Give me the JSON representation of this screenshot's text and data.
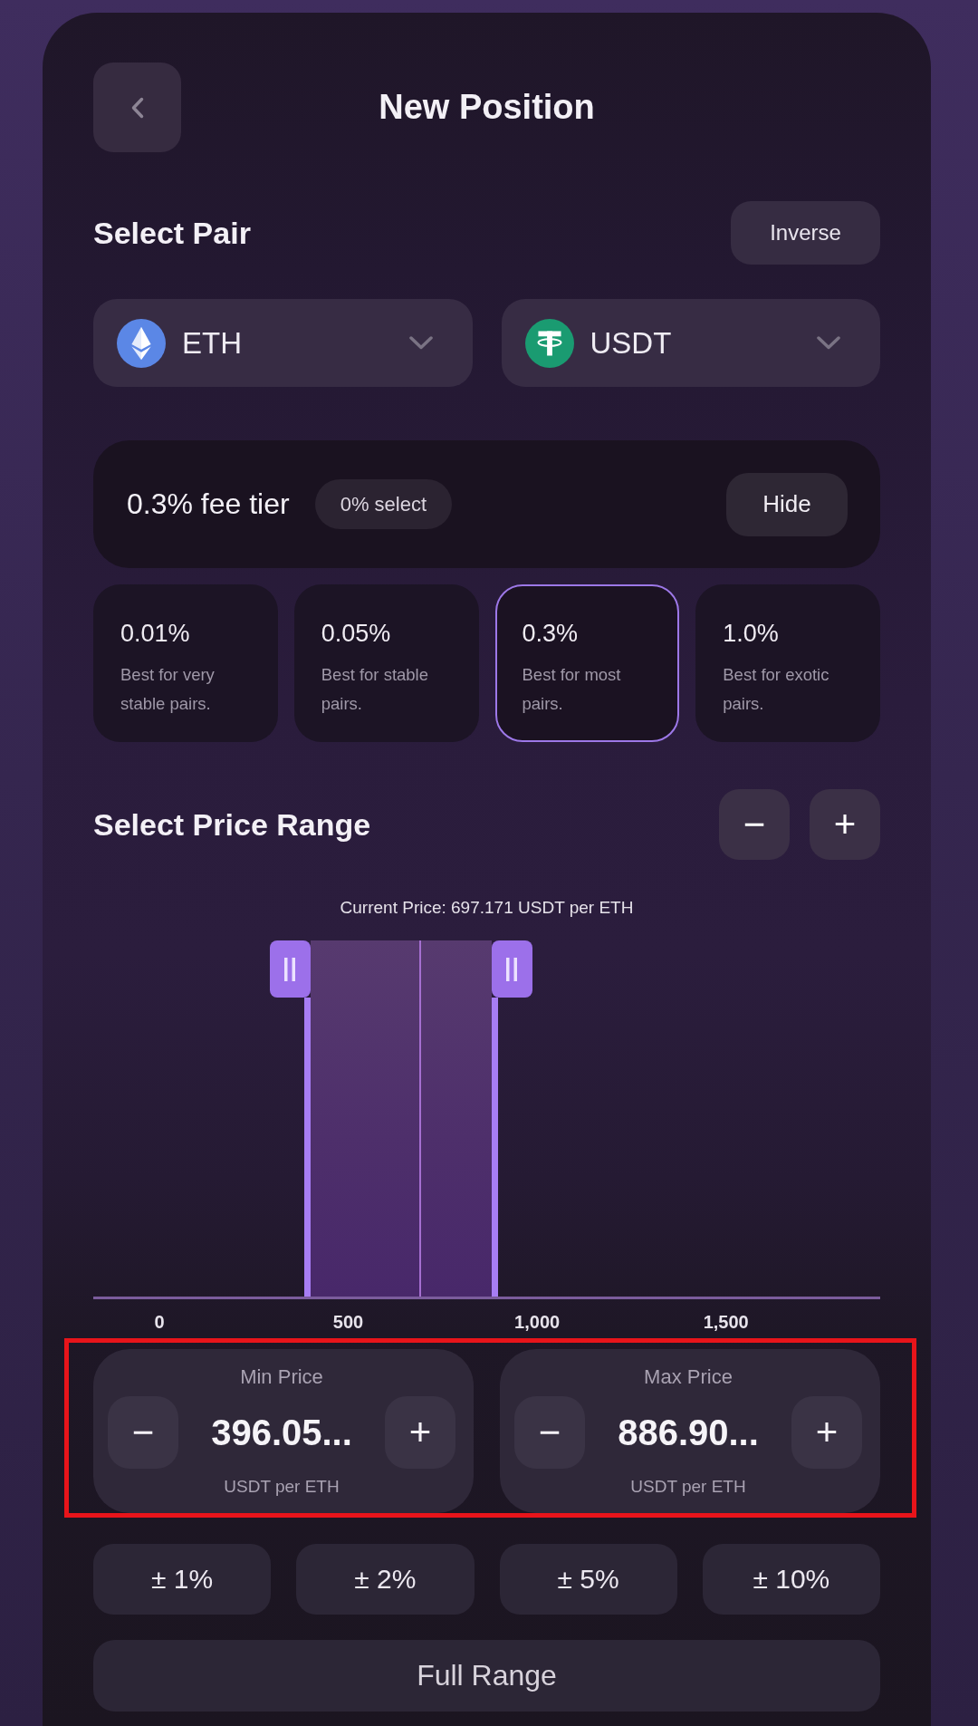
{
  "header": {
    "title": "New Position"
  },
  "pair": {
    "title": "Select Pair",
    "inverse_button": "Inverse",
    "tokens": [
      {
        "symbol": "ETH",
        "kind": "eth"
      },
      {
        "symbol": "USDT",
        "kind": "usdt"
      }
    ]
  },
  "fee_tier": {
    "label": "0.3% fee tier",
    "badge": "0% select",
    "hide_button": "Hide",
    "options": [
      {
        "fee": "0.01%",
        "description": "Best for very stable pairs.",
        "selected": false
      },
      {
        "fee": "0.05%",
        "description": "Best for stable pairs.",
        "selected": false
      },
      {
        "fee": "0.3%",
        "description": "Best for most pairs.",
        "selected": true
      },
      {
        "fee": "1.0%",
        "description": "Best for exotic pairs.",
        "selected": false
      }
    ]
  },
  "price_range": {
    "title": "Select Price Range",
    "zoom_buttons": [
      "−",
      "+"
    ],
    "current_price": "Current Price: 697.171 USDT per ETH",
    "current_marker": {
      "level": 0.415
    },
    "min_handle": {
      "level": 0.272
    },
    "max_handle": {
      "level": 0.51
    },
    "axis_labels": [
      "0",
      "500",
      "1,000",
      "1,500"
    ]
  },
  "price_inputs": {
    "highlighted": true,
    "cards": [
      {
        "label": "Min Price",
        "decrement": "−",
        "value": "396.05...",
        "increment": "+",
        "unit": "USDT per ETH"
      },
      {
        "label": "Max Price",
        "decrement": "−",
        "value": "886.90...",
        "increment": "+",
        "unit": "USDT per ETH"
      }
    ]
  },
  "presets": [
    "± 1%",
    "± 2%",
    "± 5%",
    "± 10%"
  ],
  "full_range_button": "Full Range"
}
